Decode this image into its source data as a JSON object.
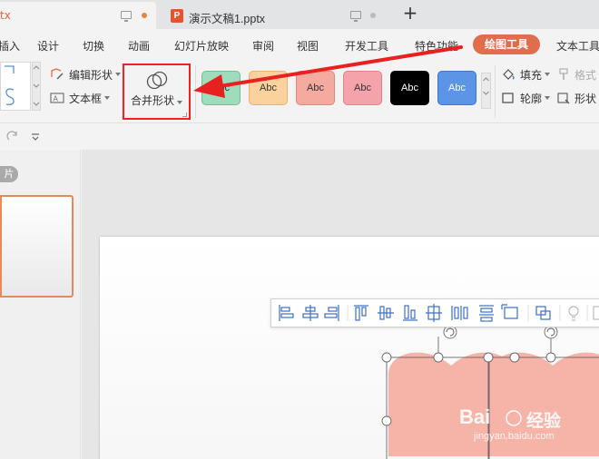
{
  "tabs": [
    {
      "name": "tx",
      "active": true
    },
    {
      "name": "演示文稿1.pptx",
      "active": false,
      "icon_letter": "P"
    }
  ],
  "menu": {
    "items": [
      "插入",
      "设计",
      "切换",
      "动画",
      "幻灯片放映",
      "审阅",
      "视图",
      "开发工具",
      "特色功能",
      "绘图工具",
      "文本工具"
    ],
    "active": "绘图工具"
  },
  "ribbon": {
    "edit_shape": "编辑形状",
    "text_box": "文本框",
    "merge_shapes": "合并形状",
    "style_label": "Abc",
    "fill": "填充",
    "outline": "轮廓",
    "format": "格式",
    "shape_effects": "形状"
  },
  "style_presets": [
    {
      "bg": "#9fdcbc",
      "border": "#6fc096",
      "text": "#333333"
    },
    {
      "bg": "#fbd29d",
      "border": "#efb16a",
      "text": "#333333"
    },
    {
      "bg": "#f5aaa0",
      "border": "#e7877b",
      "text": "#333333"
    },
    {
      "bg": "#f4a3ab",
      "border": "#e67f8a",
      "text": "#333333"
    },
    {
      "bg": "#000000",
      "border": "#000000",
      "text": "#ffffff"
    },
    {
      "bg": "#5c94e6",
      "border": "#3f77cc",
      "text": "#ffffff"
    }
  ],
  "panel": {
    "pill_label": "片"
  },
  "watermark": {
    "brand_a": "Bai",
    "brand_b": "经验",
    "sub": "jingyan.baidu.com"
  },
  "colors": {
    "accent": "#e16d4d",
    "highlight": "#ee2222",
    "heart": "#f6b4a8"
  }
}
